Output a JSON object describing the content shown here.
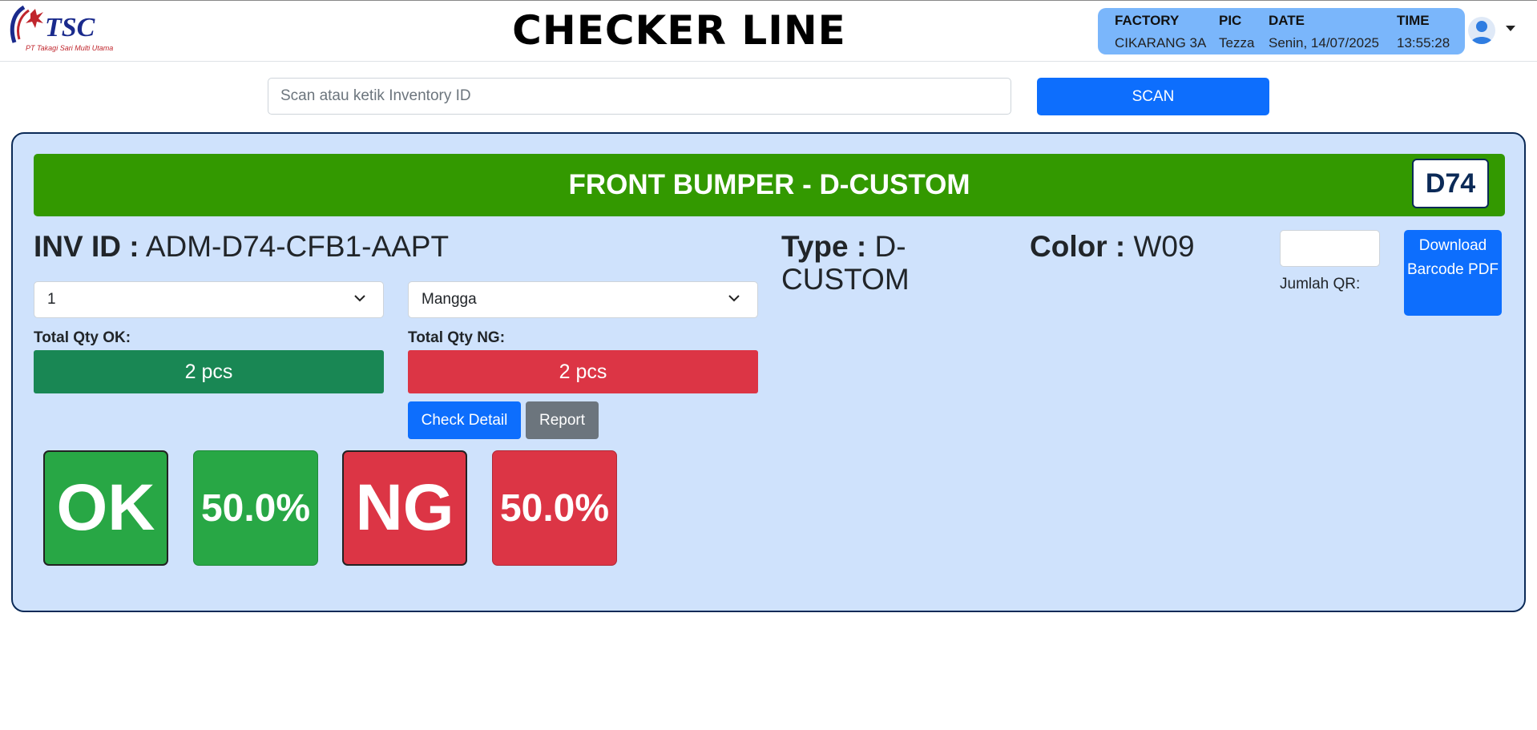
{
  "logo": {
    "mark": "TSC",
    "tagline": "PT Takagi Sari Multi Utama"
  },
  "header": {
    "title": "CHECKER LINE"
  },
  "info": {
    "factory_label": "FACTORY",
    "factory_value": "CIKARANG 3A",
    "pic_label": "PIC",
    "pic_value": "Tezza",
    "date_label": "DATE",
    "date_value": "Senin, 14/07/2025",
    "time_label": "TIME",
    "time_value": "13:55:28"
  },
  "scan": {
    "placeholder": "Scan atau ketik Inventory ID",
    "button_label": "SCAN"
  },
  "product": {
    "title": "FRONT BUMPER - D-CUSTOM",
    "code": "D74",
    "inv_label": "INV ID :",
    "inv_value": "ADM-D74-CFB1-AAPT",
    "type_label": "Type :",
    "type_value": "D-CUSTOM",
    "color_label": "Color :",
    "color_value": "W09"
  },
  "qr": {
    "label": "Jumlah QR:",
    "download_label": "Download Barcode PDF"
  },
  "selects": {
    "first_value": "1",
    "second_value": "Mangga"
  },
  "qty": {
    "ok_label": "Total Qty OK:",
    "ok_value": "2 pcs",
    "ng_label": "Total Qty NG:",
    "ng_value": "2 pcs"
  },
  "actions": {
    "check_detail": "Check Detail",
    "report": "Report"
  },
  "summary": {
    "ok_label": "OK",
    "ok_percent": "50.0%",
    "ng_label": "NG",
    "ng_percent": "50.0%"
  },
  "colors": {
    "ok_green": "#28a745",
    "ng_red": "#dc3545",
    "banner_green": "#339900",
    "primary_blue": "#0d6efd",
    "qty_ok_green": "#198754",
    "secondary_gray": "#6c757d"
  }
}
